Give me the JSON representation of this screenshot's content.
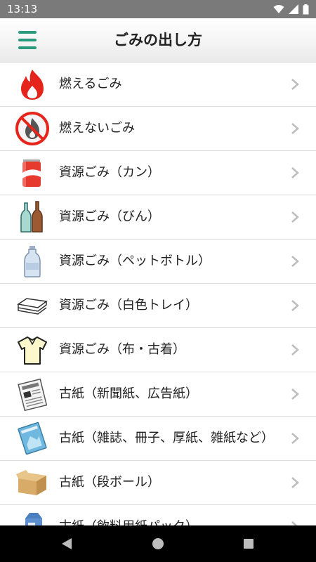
{
  "status": {
    "time": "13:13"
  },
  "header": {
    "title": "ごみの出し方",
    "menu_icon": "hamburger-menu-icon"
  },
  "items": [
    {
      "label": "燃えるごみ",
      "icon": "flame-icon"
    },
    {
      "label": "燃えないごみ",
      "icon": "no-burn-icon"
    },
    {
      "label": "資源ごみ（カン）",
      "icon": "can-icon"
    },
    {
      "label": "資源ごみ（びん）",
      "icon": "bottles-icon"
    },
    {
      "label": "資源ごみ（ペットボトル）",
      "icon": "pet-bottle-icon"
    },
    {
      "label": "資源ごみ（白色トレイ）",
      "icon": "tray-icon"
    },
    {
      "label": "資源ごみ（布・古着）",
      "icon": "shirt-icon"
    },
    {
      "label": "古紙（新聞紙、広告紙）",
      "icon": "newspaper-icon"
    },
    {
      "label": "古紙（雑誌、冊子、厚紙、雑紙など）",
      "icon": "magazine-icon"
    },
    {
      "label": "古紙（段ボール）",
      "icon": "cardboard-box-icon"
    },
    {
      "label": "古紙（飲料用紙パック）",
      "icon": "milk-carton-icon"
    }
  ],
  "colors": {
    "accent": "#2b9a7c",
    "flame": "#e5251b",
    "status_bar": "#7a7a7a"
  }
}
